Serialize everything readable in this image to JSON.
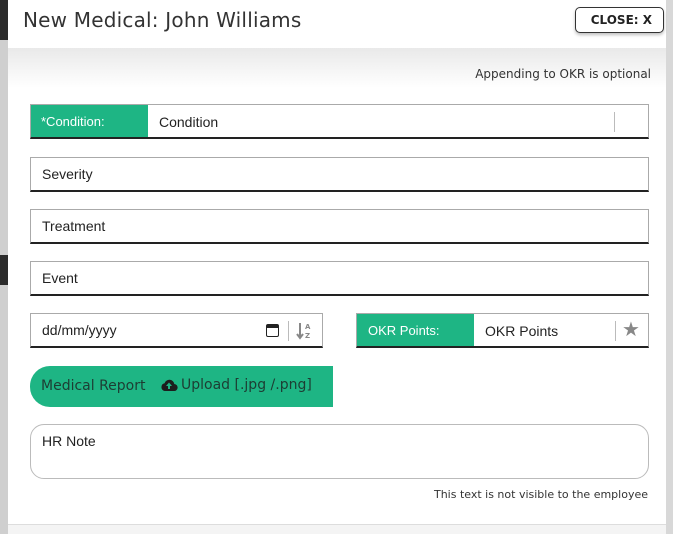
{
  "header": {
    "title": "New Medical: John Williams",
    "close_label": "CLOSE: X"
  },
  "form": {
    "okr_note": "Appending to OKR is optional",
    "condition": {
      "label": "*Condition:",
      "value": "Condition"
    },
    "severity": {
      "placeholder": "Severity"
    },
    "treatment": {
      "placeholder": "Treatment"
    },
    "event": {
      "placeholder": "Event"
    },
    "date": {
      "placeholder": "dd/mm/yyyy",
      "icon": "calendar-icon",
      "sort_icon": "sort-az-icon"
    },
    "okr_points": {
      "label": "OKR Points:",
      "placeholder": "OKR Points",
      "icon": "star-icon"
    },
    "medical_report": {
      "label": "Medical Report",
      "upload_label": "Upload [.jpg /.png]",
      "icon": "cloud-upload-icon"
    },
    "hr_note": {
      "placeholder": "HR Note"
    },
    "hr_note_hint": "This text is not visible to the employee"
  },
  "colors": {
    "accent": "#1eb584"
  }
}
